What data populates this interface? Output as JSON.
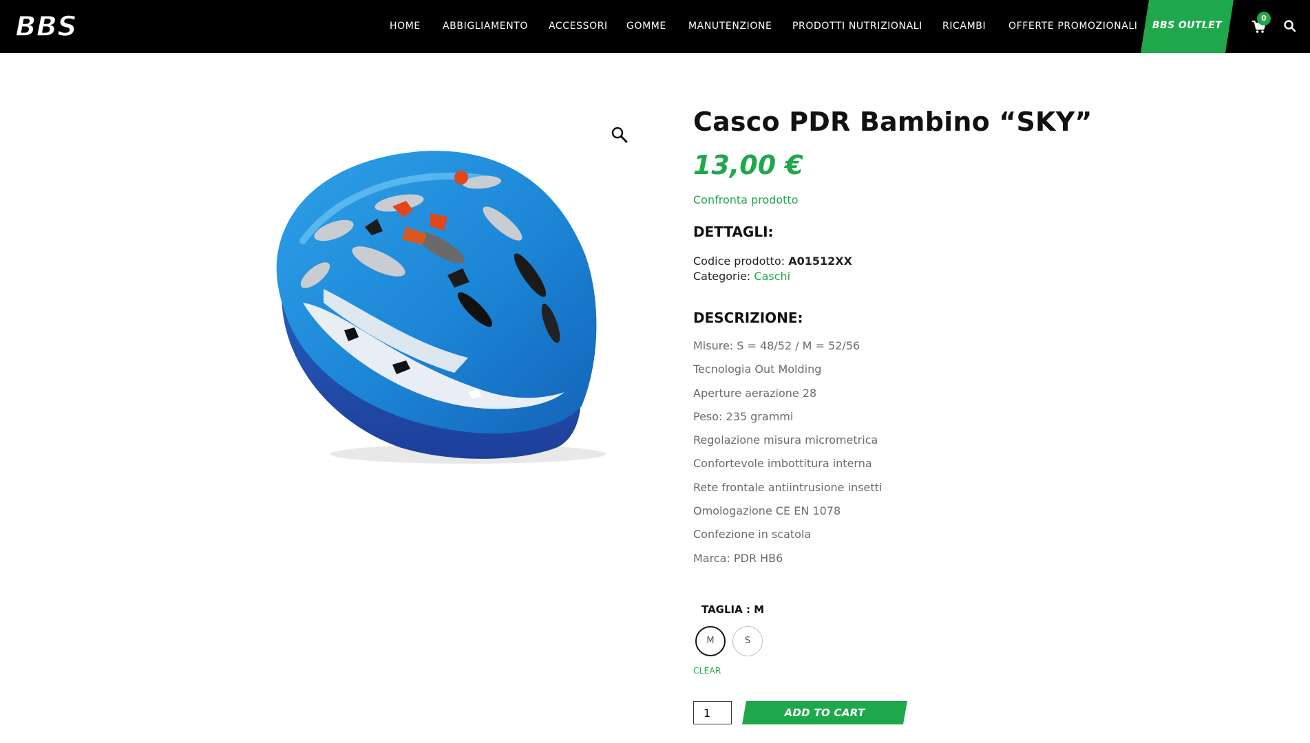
{
  "header": {
    "logo_text": "BBS",
    "nav": [
      "HOME",
      "ABBIGLIAMENTO",
      "ACCESSORI",
      "GOMME",
      "MANUTENZIONE",
      "PRODOTTI NUTRIZIONALI",
      "RICAMBI",
      "OFFERTE PROMOZIONALI"
    ],
    "outlet_label": "BBS OUTLET",
    "cart_count": "0",
    "icons": {
      "cart": "cart-icon",
      "search": "search-icon"
    },
    "colors": {
      "bar": "#000000",
      "accent": "#1fa84b"
    }
  },
  "gallery": {
    "zoom_icon": "magnifier-icon",
    "image": "blue-bicycle-helmet"
  },
  "product": {
    "title": "Casco PDR Bambino “SKY”",
    "price": "13,00 €",
    "compare": "Confronta prodotto",
    "details_heading": "DETTAGLI:",
    "code_label": "Codice prodotto: ",
    "code_value": "A01512XX",
    "category_label": "Categorie: ",
    "category_value": "Caschi",
    "description_heading": "DESCRIZIONE:",
    "description": [
      "Misure: S = 48/52 / M = 52/56",
      "Tecnologia Out Molding",
      "Aperture aerazione 28",
      "Peso: 235 grammi",
      "Regolazione misura micrometrica",
      "Confortevole imbottitura interna",
      "Rete frontale antiintrusione insetti",
      "Omologazione CE EN 1078",
      "Confezione in scatola",
      "Marca: PDR HB6"
    ],
    "size_label": "TAGLIA : M",
    "sizes": [
      "M",
      "S"
    ],
    "selected_size": "M",
    "clear_label": "CLEAR",
    "quantity": "1",
    "add_to_cart": "ADD TO CART"
  }
}
